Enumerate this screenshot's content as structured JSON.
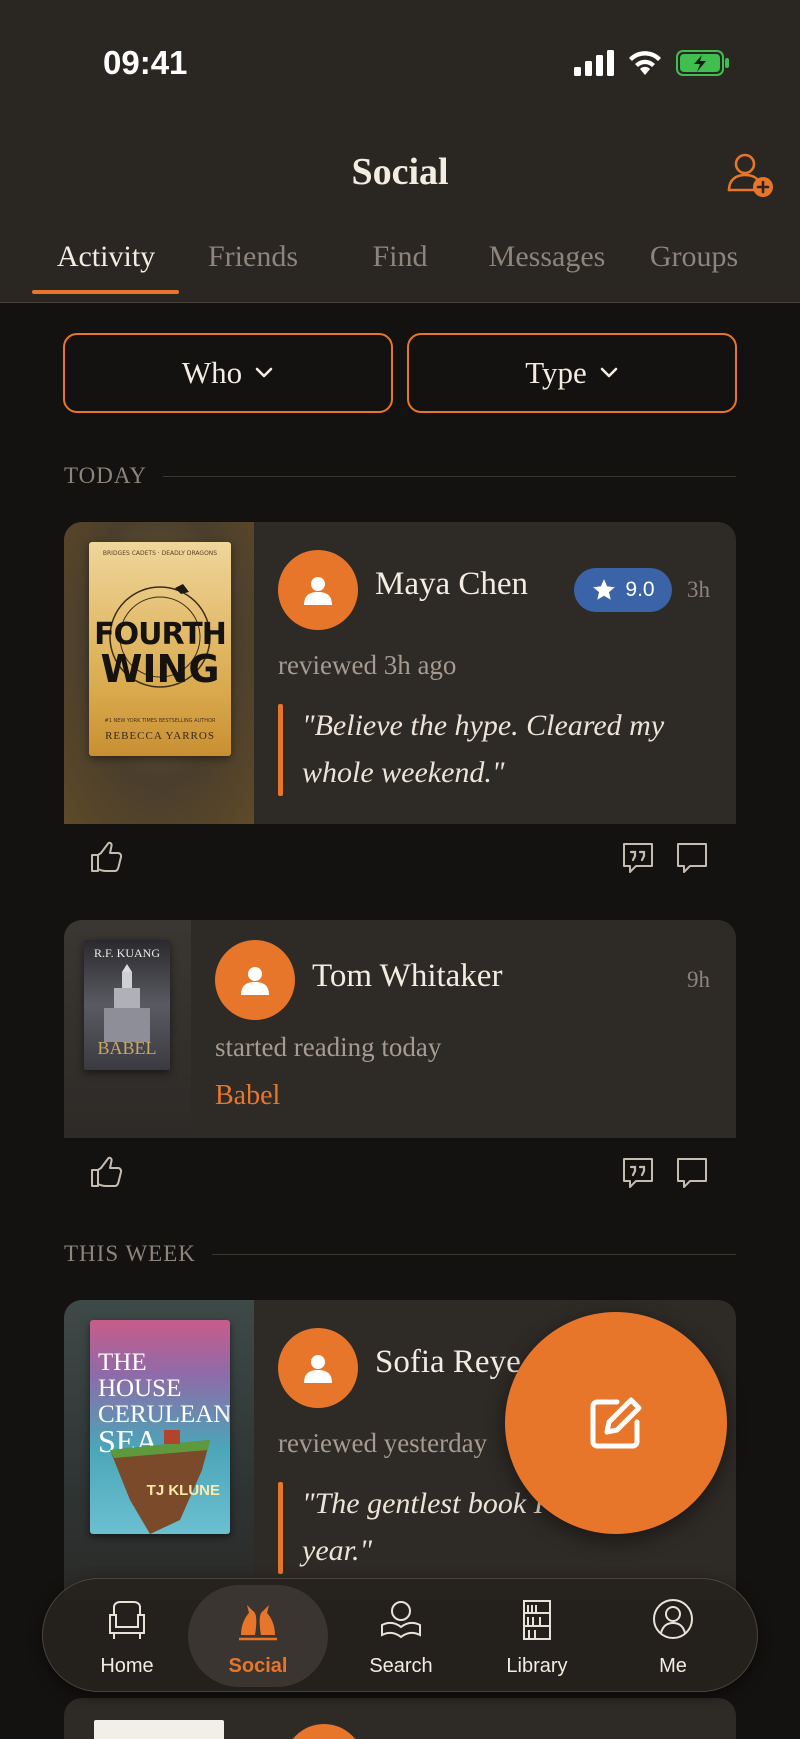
{
  "status_bar": {
    "time": "09:41"
  },
  "header": {
    "title": "Social"
  },
  "tabs": [
    {
      "label": "Activity",
      "active": true
    },
    {
      "label": "Friends",
      "active": false
    },
    {
      "label": "Find",
      "active": false
    },
    {
      "label": "Messages",
      "active": false
    },
    {
      "label": "Groups",
      "active": false
    }
  ],
  "filters": {
    "who_label": "Who",
    "type_label": "Type"
  },
  "sections": {
    "today": "TODAY",
    "this_week": "THIS WEEK"
  },
  "feed": [
    {
      "user": "Maya Chen",
      "rating": "9.0",
      "time": "3h",
      "action": "reviewed 3h ago",
      "quote": "\"Believe the hype. Cleared my whole weekend.\"",
      "book": {
        "top_line": "BRIDGES CADETS · DEADLY DRAGONS",
        "title_line1": "FOURTH",
        "title_line2": "WING",
        "blurb": "#1 NEW YORK TIMES BESTSELLING AUTHOR",
        "author": "REBECCA YARROS"
      }
    },
    {
      "user": "Tom Whitaker",
      "time": "9h",
      "action": "started reading today",
      "book_title": "Babel",
      "book": {
        "author": "R.F. KUANG",
        "title": "BABEL"
      }
    },
    {
      "user": "Sofia Reye",
      "action": "reviewed yesterday",
      "quote": "\"The gentlest book I've read all year.\"",
      "book": {
        "title_line1": "THE HOUSE",
        "title_line2": "CERULEAN",
        "title_line3": "SEA",
        "author": "TJ KLUNE"
      }
    }
  ],
  "bottom_nav": [
    {
      "label": "Home",
      "icon": "armchair-icon"
    },
    {
      "label": "Social",
      "icon": "birds-icon",
      "active": true
    },
    {
      "label": "Search",
      "icon": "book-search-icon"
    },
    {
      "label": "Library",
      "icon": "bookshelf-icon"
    },
    {
      "label": "Me",
      "icon": "portrait-icon"
    }
  ],
  "colors": {
    "accent": "#e8762a",
    "background": "#141210",
    "card": "#2e2a26",
    "rating": "#3a63a8"
  }
}
